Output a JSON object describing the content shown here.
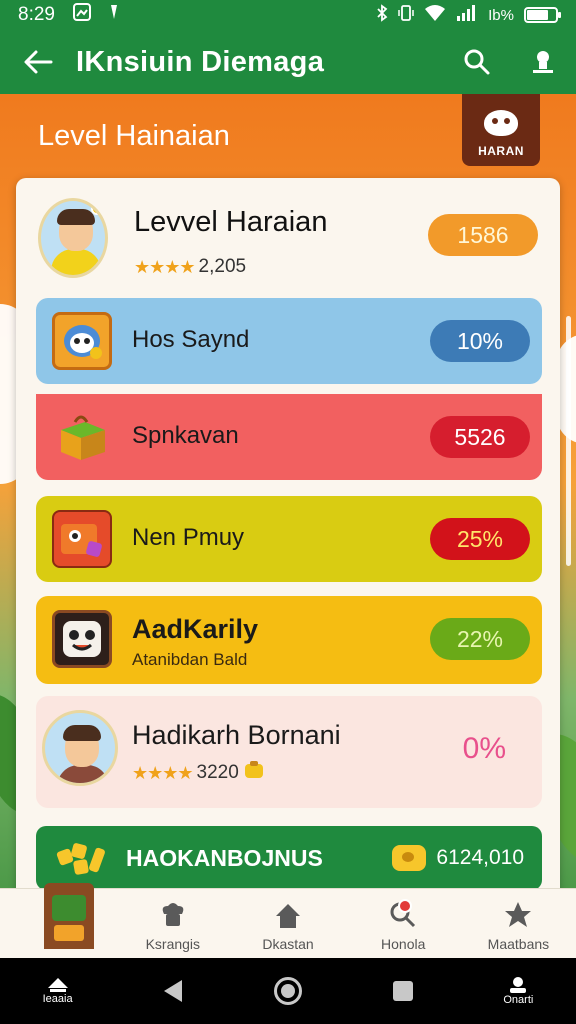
{
  "status_bar": {
    "time": "8:29",
    "battery_text": "Ib%",
    "battery_level": 0.7
  },
  "app_bar": {
    "title": "IKnsiuin Diemaga"
  },
  "header": {
    "title": "Level Hainaian",
    "badge_text": "HARAN"
  },
  "profile": {
    "name": "Levvel Haraian",
    "stars": "★★★★",
    "rating": "2,205",
    "score": "1586"
  },
  "rows": [
    {
      "label": "Hos Saynd",
      "value": "10%"
    },
    {
      "label": "Spnkavan",
      "value": "5526"
    },
    {
      "label": "Nen Pmuy",
      "value": "25%"
    },
    {
      "label": "AadKarily",
      "sub": "Atanibdan Bald",
      "value": "22%"
    },
    {
      "label": "Hadikarh Bornani",
      "stars": "★★★★",
      "rating": "3220",
      "value": "0%"
    }
  ],
  "bonus": {
    "label": "HAOKANBOJNUS",
    "amount": "6124,010"
  },
  "bottom_nav": [
    {
      "label": ""
    },
    {
      "label": "Ksrangis"
    },
    {
      "label": "Dkastan"
    },
    {
      "label": "Honola"
    },
    {
      "label": "Maatbans"
    }
  ],
  "system_nav": {
    "left_label": "Ieaaia",
    "right_label": "Onarti"
  },
  "colors": {
    "brand_green": "#1f8a3e",
    "accent_orange": "#f29a2a"
  }
}
